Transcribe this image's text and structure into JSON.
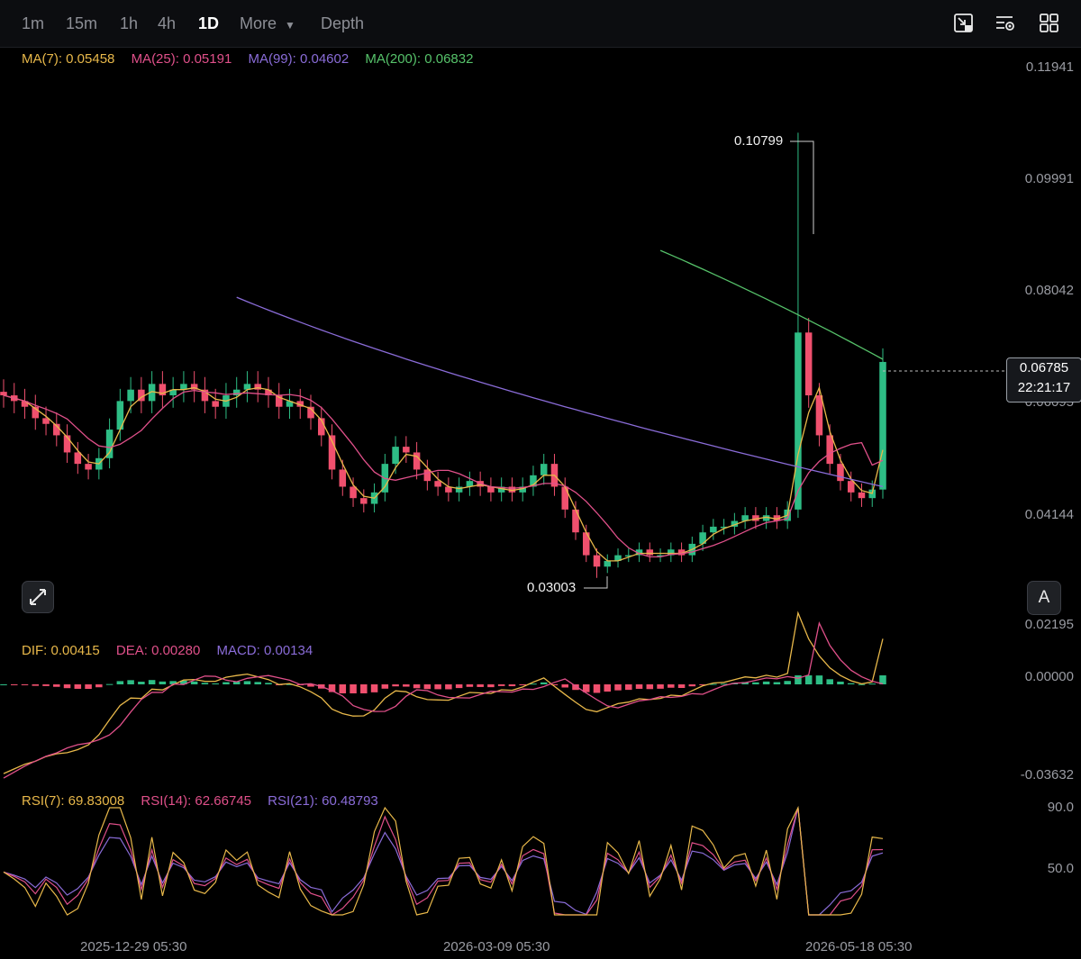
{
  "toolbar": {
    "timeframes": [
      "1m",
      "15m",
      "1h",
      "4h",
      "1D"
    ],
    "active_timeframe": "1D",
    "more_label": "More",
    "depth_label": "Depth",
    "icons": [
      "chart-type-icon",
      "indicator-settings-icon",
      "layout-grid-icon"
    ]
  },
  "price_legend": {
    "ma7": "MA(7): 0.05458",
    "ma25": "MA(25): 0.05191",
    "ma99": "MA(99): 0.04602",
    "ma200": "MA(200): 0.06832"
  },
  "macd_legend": {
    "dif": "DIF: 0.00415",
    "dea": "DEA: 0.00280",
    "macd": "MACD: 0.00134"
  },
  "rsi_legend": {
    "rsi7": "RSI(7): 69.83008",
    "rsi14": "RSI(14): 62.66745",
    "rsi21": "RSI(21): 60.48793"
  },
  "price_axis": [
    "0.11941",
    "0.09991",
    "0.08042",
    "0.06095",
    "0.04144",
    "0.02195"
  ],
  "macd_axis": [
    "0.00000",
    "-0.03632"
  ],
  "rsi_axis": [
    "90.0",
    "50.0"
  ],
  "dates": [
    "2025-12-29 05:30",
    "2026-03-09 05:30",
    "2026-05-18 05:30"
  ],
  "current_price": {
    "price": "0.06785",
    "countdown": "22:21:17"
  },
  "annotations": {
    "high": "0.10799",
    "low": "0.03003"
  },
  "auto_button": "A",
  "colors": {
    "ma7": "#e8b84a",
    "ma25": "#e0508a",
    "ma99": "#8a6cd8",
    "ma200": "#56c26a",
    "up": "#2ebd85",
    "down": "#f0506e",
    "background": "#000000"
  },
  "chart_data": {
    "type": "candlestick",
    "price_range": [
      0.02195,
      0.11941
    ],
    "high_marker": 0.10799,
    "low_marker": 0.03003,
    "last_price": 0.06785,
    "moving_averages": {
      "MA(7)": 0.05458,
      "MA(25)": 0.05191,
      "MA(99)": 0.04602,
      "MA(200)": 0.06832
    },
    "macd": {
      "DIF": 0.00415,
      "DEA": 0.0028,
      "MACD": 0.00134,
      "range": [
        -0.03632,
        0.0
      ]
    },
    "rsi": {
      "RSI(7)": 69.83008,
      "RSI(14)": 62.66745,
      "RSI(21)": 60.48793
    },
    "close_series": [
      0.062,
      0.061,
      0.06,
      0.058,
      0.057,
      0.055,
      0.052,
      0.05,
      0.049,
      0.051,
      0.056,
      0.061,
      0.063,
      0.061,
      0.064,
      0.062,
      0.063,
      0.064,
      0.063,
      0.061,
      0.06,
      0.062,
      0.063,
      0.064,
      0.063,
      0.062,
      0.06,
      0.061,
      0.06,
      0.058,
      0.055,
      0.049,
      0.046,
      0.044,
      0.043,
      0.045,
      0.05,
      0.053,
      0.052,
      0.049,
      0.047,
      0.046,
      0.045,
      0.046,
      0.047,
      0.046,
      0.045,
      0.046,
      0.045,
      0.046,
      0.048,
      0.05,
      0.046,
      0.042,
      0.038,
      0.034,
      0.032,
      0.033,
      0.034,
      0.034,
      0.035,
      0.034,
      0.034,
      0.035,
      0.034,
      0.036,
      0.038,
      0.039,
      0.039,
      0.04,
      0.041,
      0.04,
      0.041,
      0.04,
      0.042,
      0.073,
      0.062,
      0.055,
      0.05,
      0.047,
      0.045,
      0.044,
      0.0455,
      0.06785
    ]
  }
}
